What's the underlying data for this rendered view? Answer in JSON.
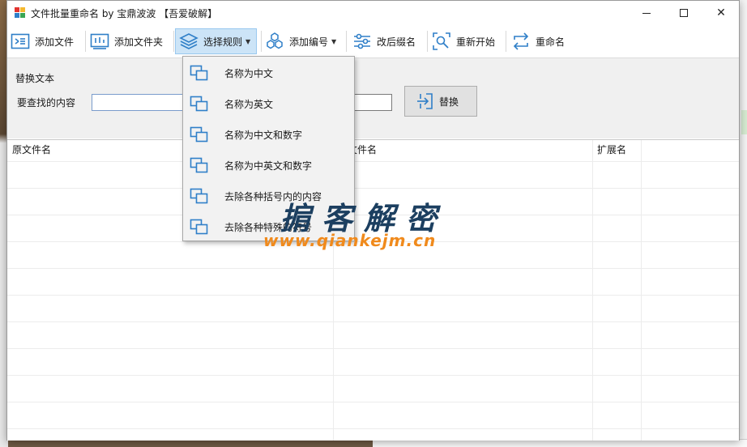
{
  "window": {
    "title": "文件批量重命名 by 宝鼎波波 【吾爱破解】"
  },
  "toolbar": {
    "add_file": "添加文件",
    "add_folder": "添加文件夹",
    "select_rule": "选择规则",
    "add_number": "添加编号",
    "change_ext": "改后缀名",
    "restart": "重新开始",
    "rename": "重命名"
  },
  "panel": {
    "title": "替换文本",
    "find_label": "要查找的内容",
    "find_value": "",
    "replace_value": "",
    "replace_button": "替换"
  },
  "grid": {
    "columns": [
      "原文件名",
      "新文件名",
      "扩展名"
    ],
    "rows": []
  },
  "rule_menu": {
    "items": [
      "名称为中文",
      "名称为英文",
      "名称为中文和数字",
      "名称为中英文和数字",
      "去除各种括号内的内容",
      "去除各种特殊的符号"
    ]
  },
  "watermark": {
    "text": "掮客解密",
    "url": "www.qiankejm.cn"
  },
  "colors": {
    "icon_blue": "#2f7fc8",
    "menu_bg": "#f2f2f2",
    "active_tool_bg": "#cce4f7",
    "watermark_dark": "#1c3f60",
    "watermark_orange": "#f08a1c"
  }
}
